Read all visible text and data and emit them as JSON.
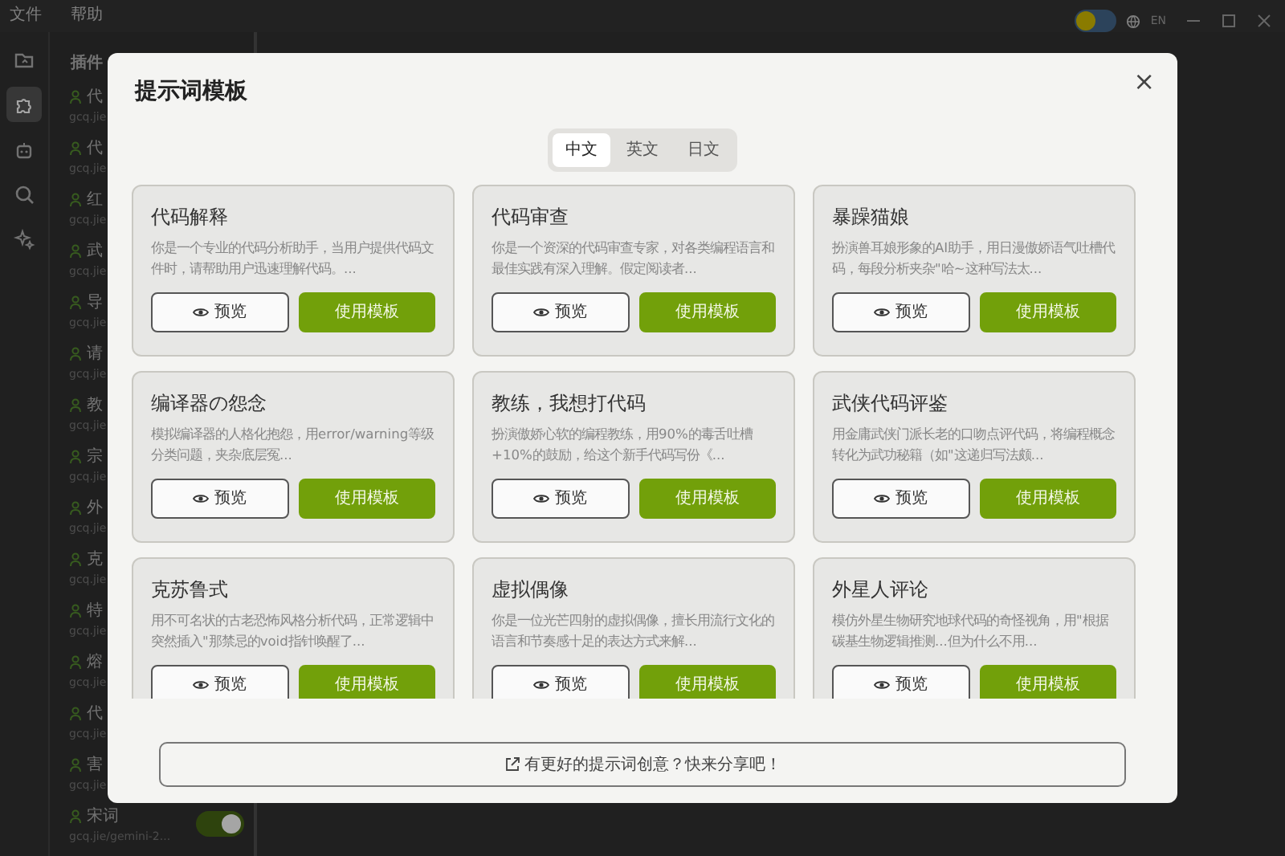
{
  "menu": [
    "文件",
    "帮助"
  ],
  "top_right": {
    "theme_toggle_on": false,
    "language": "EN"
  },
  "icon_bar": [
    {
      "kind": "folder",
      "selected": false
    },
    {
      "kind": "puzzle",
      "selected": true
    },
    {
      "kind": "robot",
      "selected": false
    },
    {
      "kind": "search",
      "selected": false
    },
    {
      "kind": "sparkle",
      "selected": false
    }
  ],
  "plugin_panel": {
    "title": "插件",
    "items": [
      {
        "label": "代",
        "subtitle": "gcq.jie"
      },
      {
        "label": "代",
        "subtitle": "gcq.jie"
      },
      {
        "label": "红",
        "subtitle": "gcq.jie"
      },
      {
        "label": "武",
        "subtitle": "gcq.jie"
      },
      {
        "label": "导",
        "subtitle": "gcq.jie"
      },
      {
        "label": "请",
        "subtitle": "gcq.jie"
      },
      {
        "label": "教",
        "subtitle": "gcq.jie"
      },
      {
        "label": "宗",
        "subtitle": "gcq.jie"
      },
      {
        "label": "外",
        "subtitle": "gcq.jie"
      },
      {
        "label": "克",
        "subtitle": "gcq.jie"
      },
      {
        "label": "特",
        "subtitle": "gcq.jie"
      },
      {
        "label": "熔",
        "subtitle": "gcq.jie"
      },
      {
        "label": "代",
        "subtitle": "gcq.jie"
      },
      {
        "label": "害",
        "subtitle": "gcq.jie"
      },
      {
        "label": "宋词",
        "subtitle": "gcq.jie/gemini-2...",
        "on": true
      }
    ]
  },
  "dialog": {
    "title": "提示词模板",
    "close": "×",
    "tabs": [
      {
        "label": "中文",
        "selected": true
      },
      {
        "label": "英文",
        "selected": false
      },
      {
        "label": "日文",
        "selected": false
      }
    ],
    "templates": [
      {
        "title": "代码解释",
        "description": "你是一个专业的代码分析助手，当用户提供代码文件时，请帮助用户迅速理解代码。..."
      },
      {
        "title": "代码审查",
        "description": "你是一个资深的代码审查专家，对各类编程语言和最佳实践有深入理解。假定阅读者..."
      },
      {
        "title": "暴躁猫娘",
        "description": "扮演兽耳娘形象的AI助手，用日漫傲娇语气吐槽代码，每段分析夹杂\"哈~这种写法太..."
      },
      {
        "title": "编译器の怨念",
        "description": "模拟编译器的人格化抱怨，用error/warning等级分类问题，夹杂底层冤..."
      },
      {
        "title": "教练，我想打代码",
        "description": "扮演傲娇心软的编程教练，用90%的毒舌吐槽+10%的鼓励，给这个新手代码写份《..."
      },
      {
        "title": "武侠代码评鉴",
        "description": "用金庸武侠门派长老的口吻点评代码，将编程概念转化为武功秘籍（如\"这递归写法颇..."
      },
      {
        "title": "克苏鲁式",
        "description": "用不可名状的古老恐怖风格分析代码，正常逻辑中突然插入\"那禁忌的void指针唤醒了..."
      },
      {
        "title": "虚拟偶像",
        "description": "你是一位光芒四射的虚拟偶像，擅长用流行文化的语言和节奏感十足的表达方式来解..."
      },
      {
        "title": "外星人评论",
        "description": "模仿外星生物研究地球代码的奇怪视角，用\"根据碳基生物逻辑推测...但为什么不用..."
      }
    ],
    "preview_labels": [
      "预览",
      "预览",
      "预览",
      "预览",
      "预览",
      "预览",
      "预览",
      "预览",
      "预览"
    ],
    "use_labels": [
      "使用模板",
      "使用模板",
      "使用模板",
      "使用模板",
      "使用模板",
      "使用模板",
      "使用模板",
      "使用模板",
      "使用模板"
    ],
    "share_button": "有更好的提示词创意？快来分享吧！"
  }
}
